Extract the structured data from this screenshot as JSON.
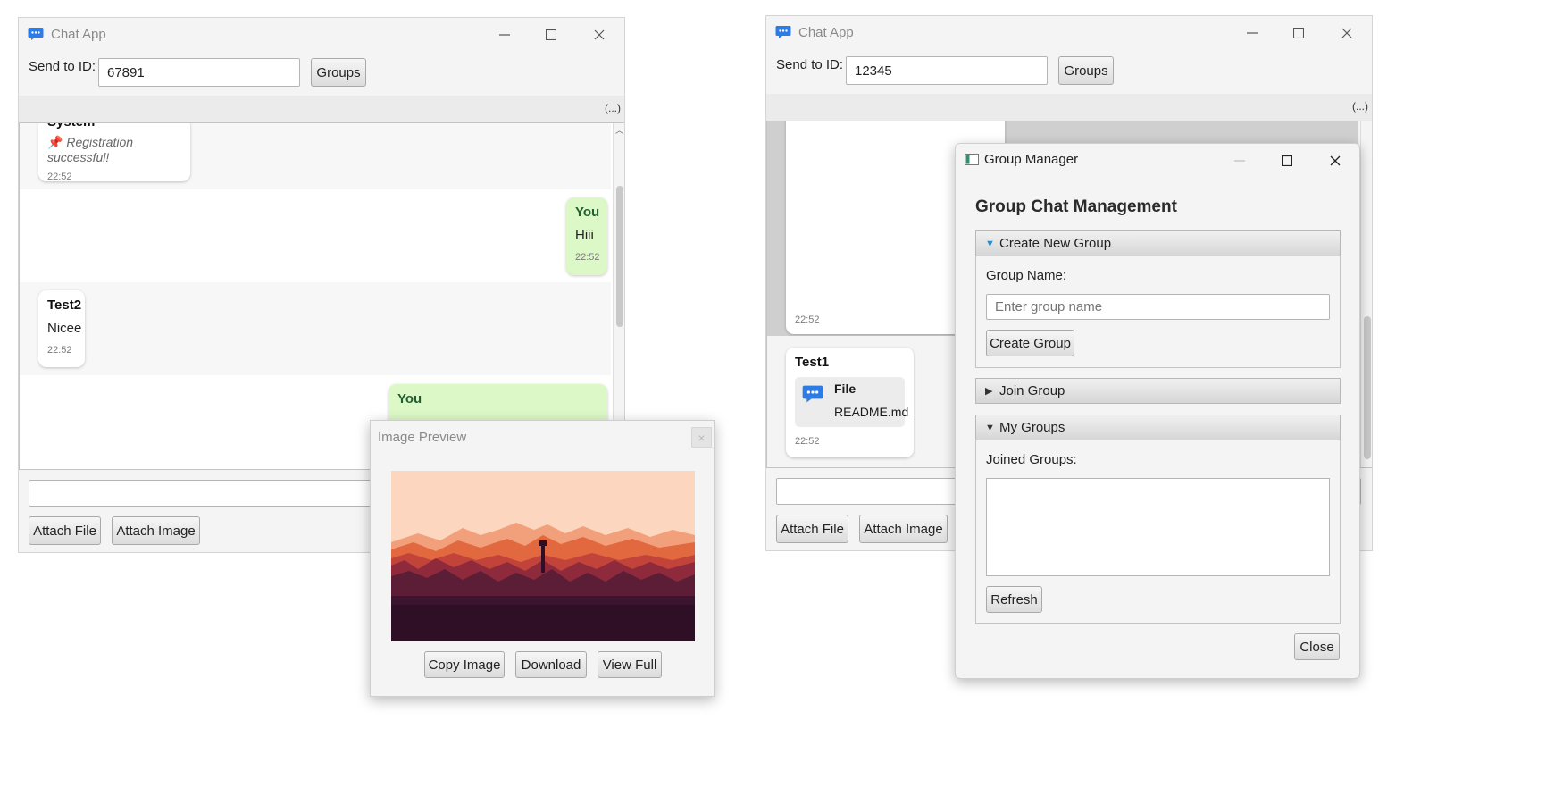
{
  "window1": {
    "title": "Chat App",
    "send_to_label": "Send to ID:",
    "send_to_value": "67891",
    "groups_button": "Groups",
    "ellipsis": "(...)",
    "messages": [
      {
        "sender": "System",
        "text": "Registration successful!",
        "time": "22:52"
      },
      {
        "sender": "You",
        "text": "Hiii",
        "time": "22:52"
      },
      {
        "sender": "Test2",
        "text": "Nicee",
        "time": "22:52"
      },
      {
        "sender": "You",
        "text": "",
        "time": ""
      }
    ],
    "message_input_value": "",
    "attach_file_button": "Attach File",
    "attach_image_button": "Attach Image"
  },
  "image_preview": {
    "title": "Image Preview",
    "close_glyph": "×",
    "copy_button": "Copy Image",
    "download_button": "Download",
    "view_full_button": "View Full"
  },
  "window2": {
    "title": "Chat App",
    "send_to_label": "Send to ID:",
    "send_to_value": "12345",
    "groups_button": "Groups",
    "ellipsis": "(...)",
    "messages": [
      {
        "sender": "",
        "text": "",
        "time": "22:52"
      },
      {
        "sender": "Test1",
        "file_label": "File",
        "file_name": "README.md",
        "time": "22:52"
      }
    ],
    "message_input_value": "",
    "attach_file_button": "Attach File",
    "attach_image_button": "Attach Image"
  },
  "group_manager": {
    "title": "Group Manager",
    "heading": "Group Chat Management",
    "create_pane": {
      "title": "Create New Group",
      "expanded": true,
      "group_name_label": "Group Name:",
      "group_name_placeholder": "Enter group name",
      "create_button": "Create Group"
    },
    "join_pane": {
      "title": "Join Group",
      "expanded": false
    },
    "my_groups_pane": {
      "title": "My Groups",
      "expanded": true,
      "joined_label": "Joined Groups:",
      "joined_groups": [],
      "refresh_button": "Refresh"
    },
    "close_button": "Close"
  },
  "colors": {
    "my_bubble": "#dcf8c6",
    "app_icon": "#2d7be5",
    "window_bg": "#f4f4f4"
  },
  "icons": {
    "app": "chat-bubble-icon",
    "pin": "pushpin-icon",
    "file": "file-chat-icon"
  }
}
